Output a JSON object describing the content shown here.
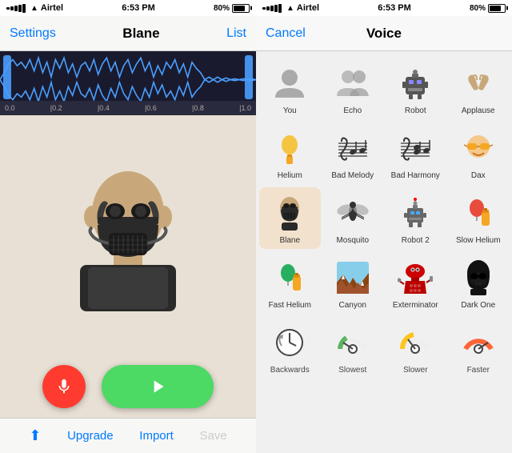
{
  "left": {
    "status": {
      "carrier": "Airtel",
      "time": "6:53 PM",
      "battery": "80%"
    },
    "nav": {
      "back_label": "Settings",
      "title": "Blane",
      "action_label": "List"
    },
    "waveform": {
      "timeline": [
        "0.0",
        "|0.2",
        "|0.4",
        "|0.6",
        "|0.8",
        "|1.0"
      ]
    },
    "character": "🎭",
    "playback": {
      "mic_label": "Record",
      "play_label": "Play"
    },
    "bottom": {
      "upgrade_label": "Upgrade",
      "import_label": "Import",
      "save_label": "Save"
    }
  },
  "right": {
    "status": {
      "carrier": "Airtel",
      "time": "6:53 PM",
      "battery": "80%"
    },
    "nav": {
      "cancel_label": "Cancel",
      "title": "Voice"
    },
    "voices": [
      {
        "id": "you",
        "label": "You",
        "icon": "👤"
      },
      {
        "id": "echo",
        "label": "Echo",
        "icon": "👥"
      },
      {
        "id": "robot",
        "label": "Robot",
        "icon": "🤖"
      },
      {
        "id": "applause",
        "label": "Applause",
        "icon": "👏"
      },
      {
        "id": "helium",
        "label": "Helium",
        "icon": "🎈"
      },
      {
        "id": "bad-melody",
        "label": "Bad Melody",
        "icon": "🎵"
      },
      {
        "id": "bad-harmony",
        "label": "Bad Harmony",
        "icon": "🎼"
      },
      {
        "id": "dax",
        "label": "Dax",
        "icon": "😎"
      },
      {
        "id": "blane",
        "label": "Blane",
        "icon": "🎭"
      },
      {
        "id": "mosquito",
        "label": "Mosquito",
        "icon": "🦟"
      },
      {
        "id": "robot2",
        "label": "Robot 2",
        "icon": "🦾"
      },
      {
        "id": "slow-helium",
        "label": "Slow Helium",
        "icon": "🔴"
      },
      {
        "id": "fast-helium",
        "label": "Fast Helium",
        "icon": "🟢"
      },
      {
        "id": "canyon",
        "label": "Canyon",
        "icon": "🏔"
      },
      {
        "id": "exterminator",
        "label": "Exterminator",
        "icon": "🔴"
      },
      {
        "id": "dark-one",
        "label": "Dark One",
        "icon": "⚫"
      },
      {
        "id": "backwards",
        "label": "Backwards",
        "icon": "🕐"
      },
      {
        "id": "slowest",
        "label": "Slowest",
        "icon": "🟡"
      },
      {
        "id": "slower",
        "label": "Slower",
        "icon": "🟠"
      },
      {
        "id": "faster",
        "label": "Faster",
        "icon": "🔴"
      }
    ]
  }
}
